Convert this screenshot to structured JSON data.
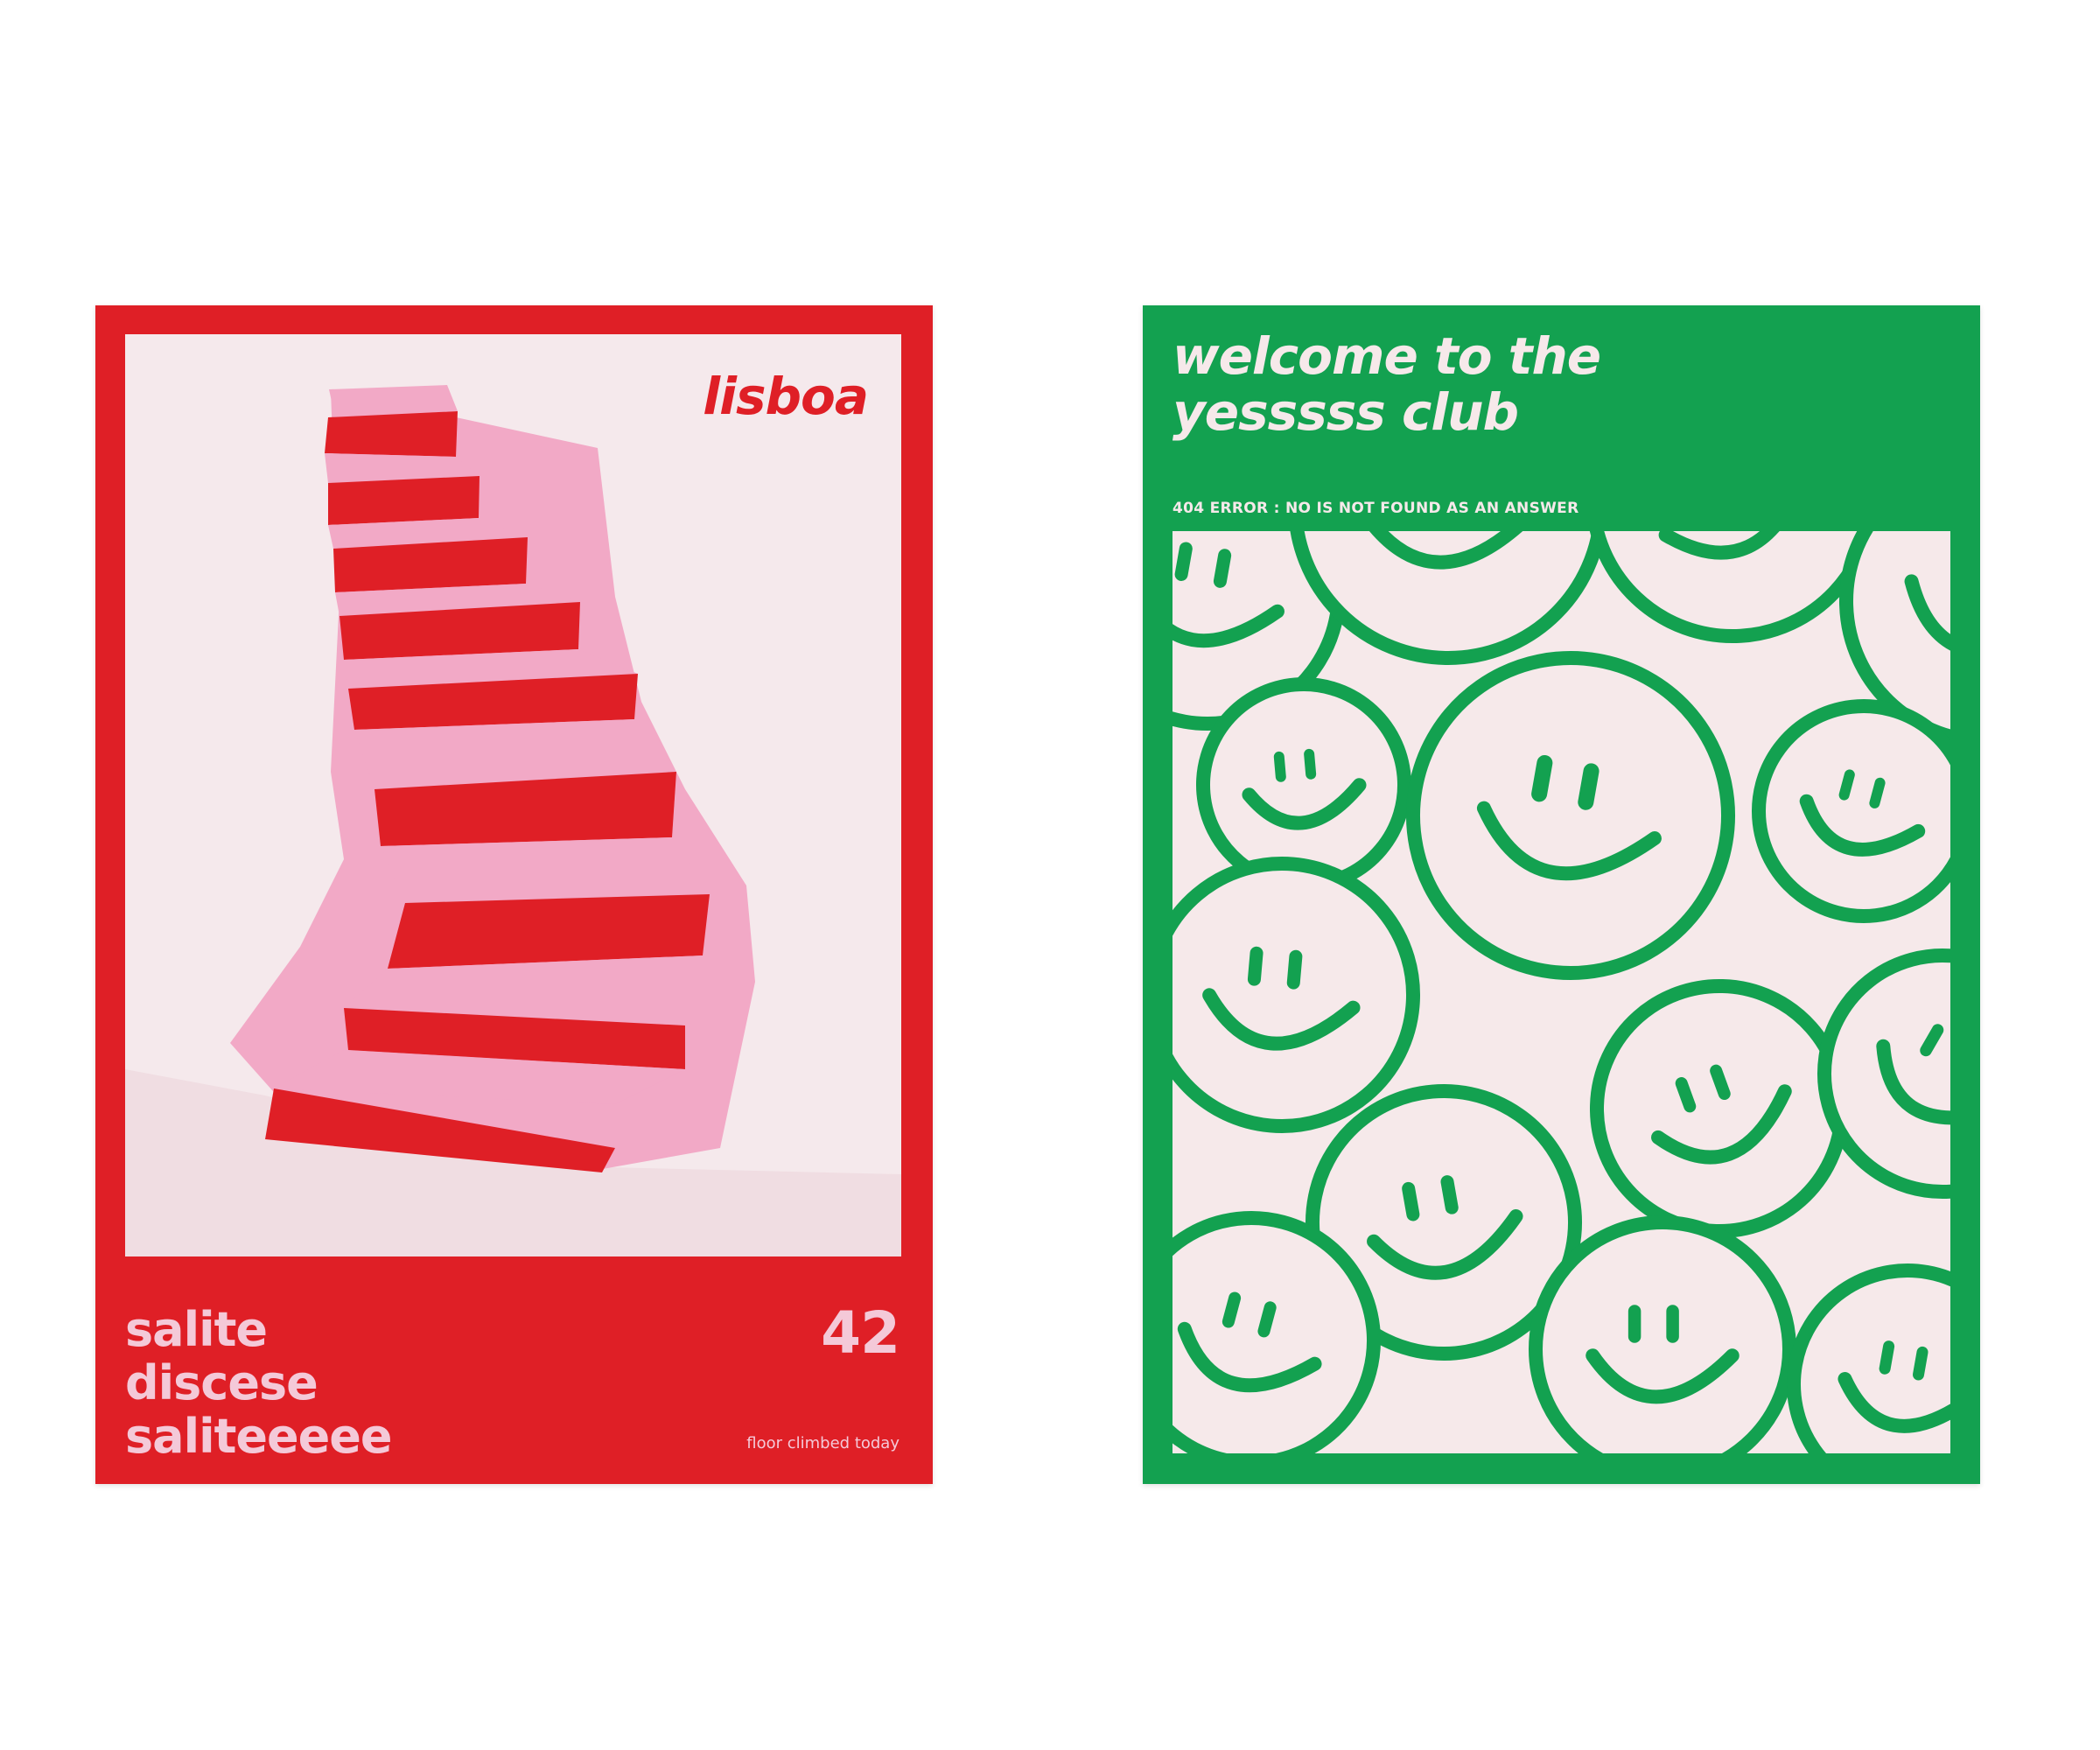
{
  "colors": {
    "red": "#df1f26",
    "pink": "#f4c9d8",
    "cream": "#f5e9ec",
    "green": "#13a150"
  },
  "poster_red": {
    "city": "lisboa",
    "verse": [
      "salite",
      "discese",
      "saliteeeee"
    ],
    "count": "42",
    "caption": "floor climbed today",
    "illustration": "spiral-staircase"
  },
  "poster_green": {
    "headline": [
      "welcome to the",
      "yesssss club"
    ],
    "subhead": "404 ERROR : NO IS NOT FOUND AS AN ANSWER",
    "illustration": "smiley-face-pattern"
  }
}
